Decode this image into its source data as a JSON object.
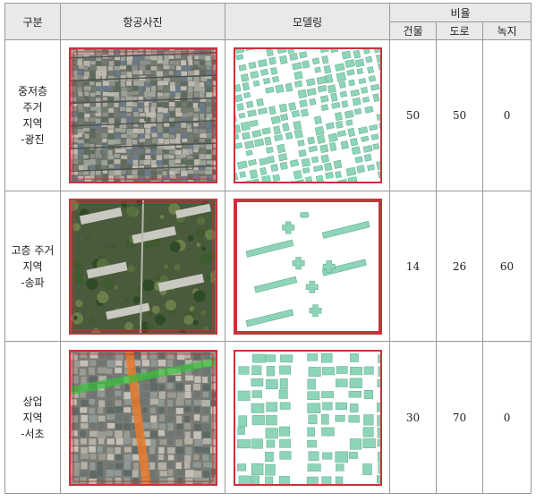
{
  "headers": {
    "category": "구분",
    "aerial": "항공사진",
    "modeling": "모델링",
    "ratio": "비율",
    "building": "건물",
    "road": "도로",
    "green": "녹지"
  },
  "rows": [
    {
      "category_lines": [
        "중저층",
        "주거",
        "지역",
        "-광진"
      ],
      "building": "50",
      "road": "50",
      "green": "0"
    },
    {
      "category_lines": [
        "고층 주거",
        "지역",
        "-송파"
      ],
      "building": "14",
      "road": "26",
      "green": "60"
    },
    {
      "category_lines": [
        "상업",
        "지역",
        "-서초"
      ],
      "building": "30",
      "road": "70",
      "green": "0"
    }
  ],
  "colors": {
    "frame_red": "#c8323a",
    "building_fill": "#8ed4b8",
    "building_stroke": "#5faa8c",
    "header_bg": "#e9e9e9"
  }
}
